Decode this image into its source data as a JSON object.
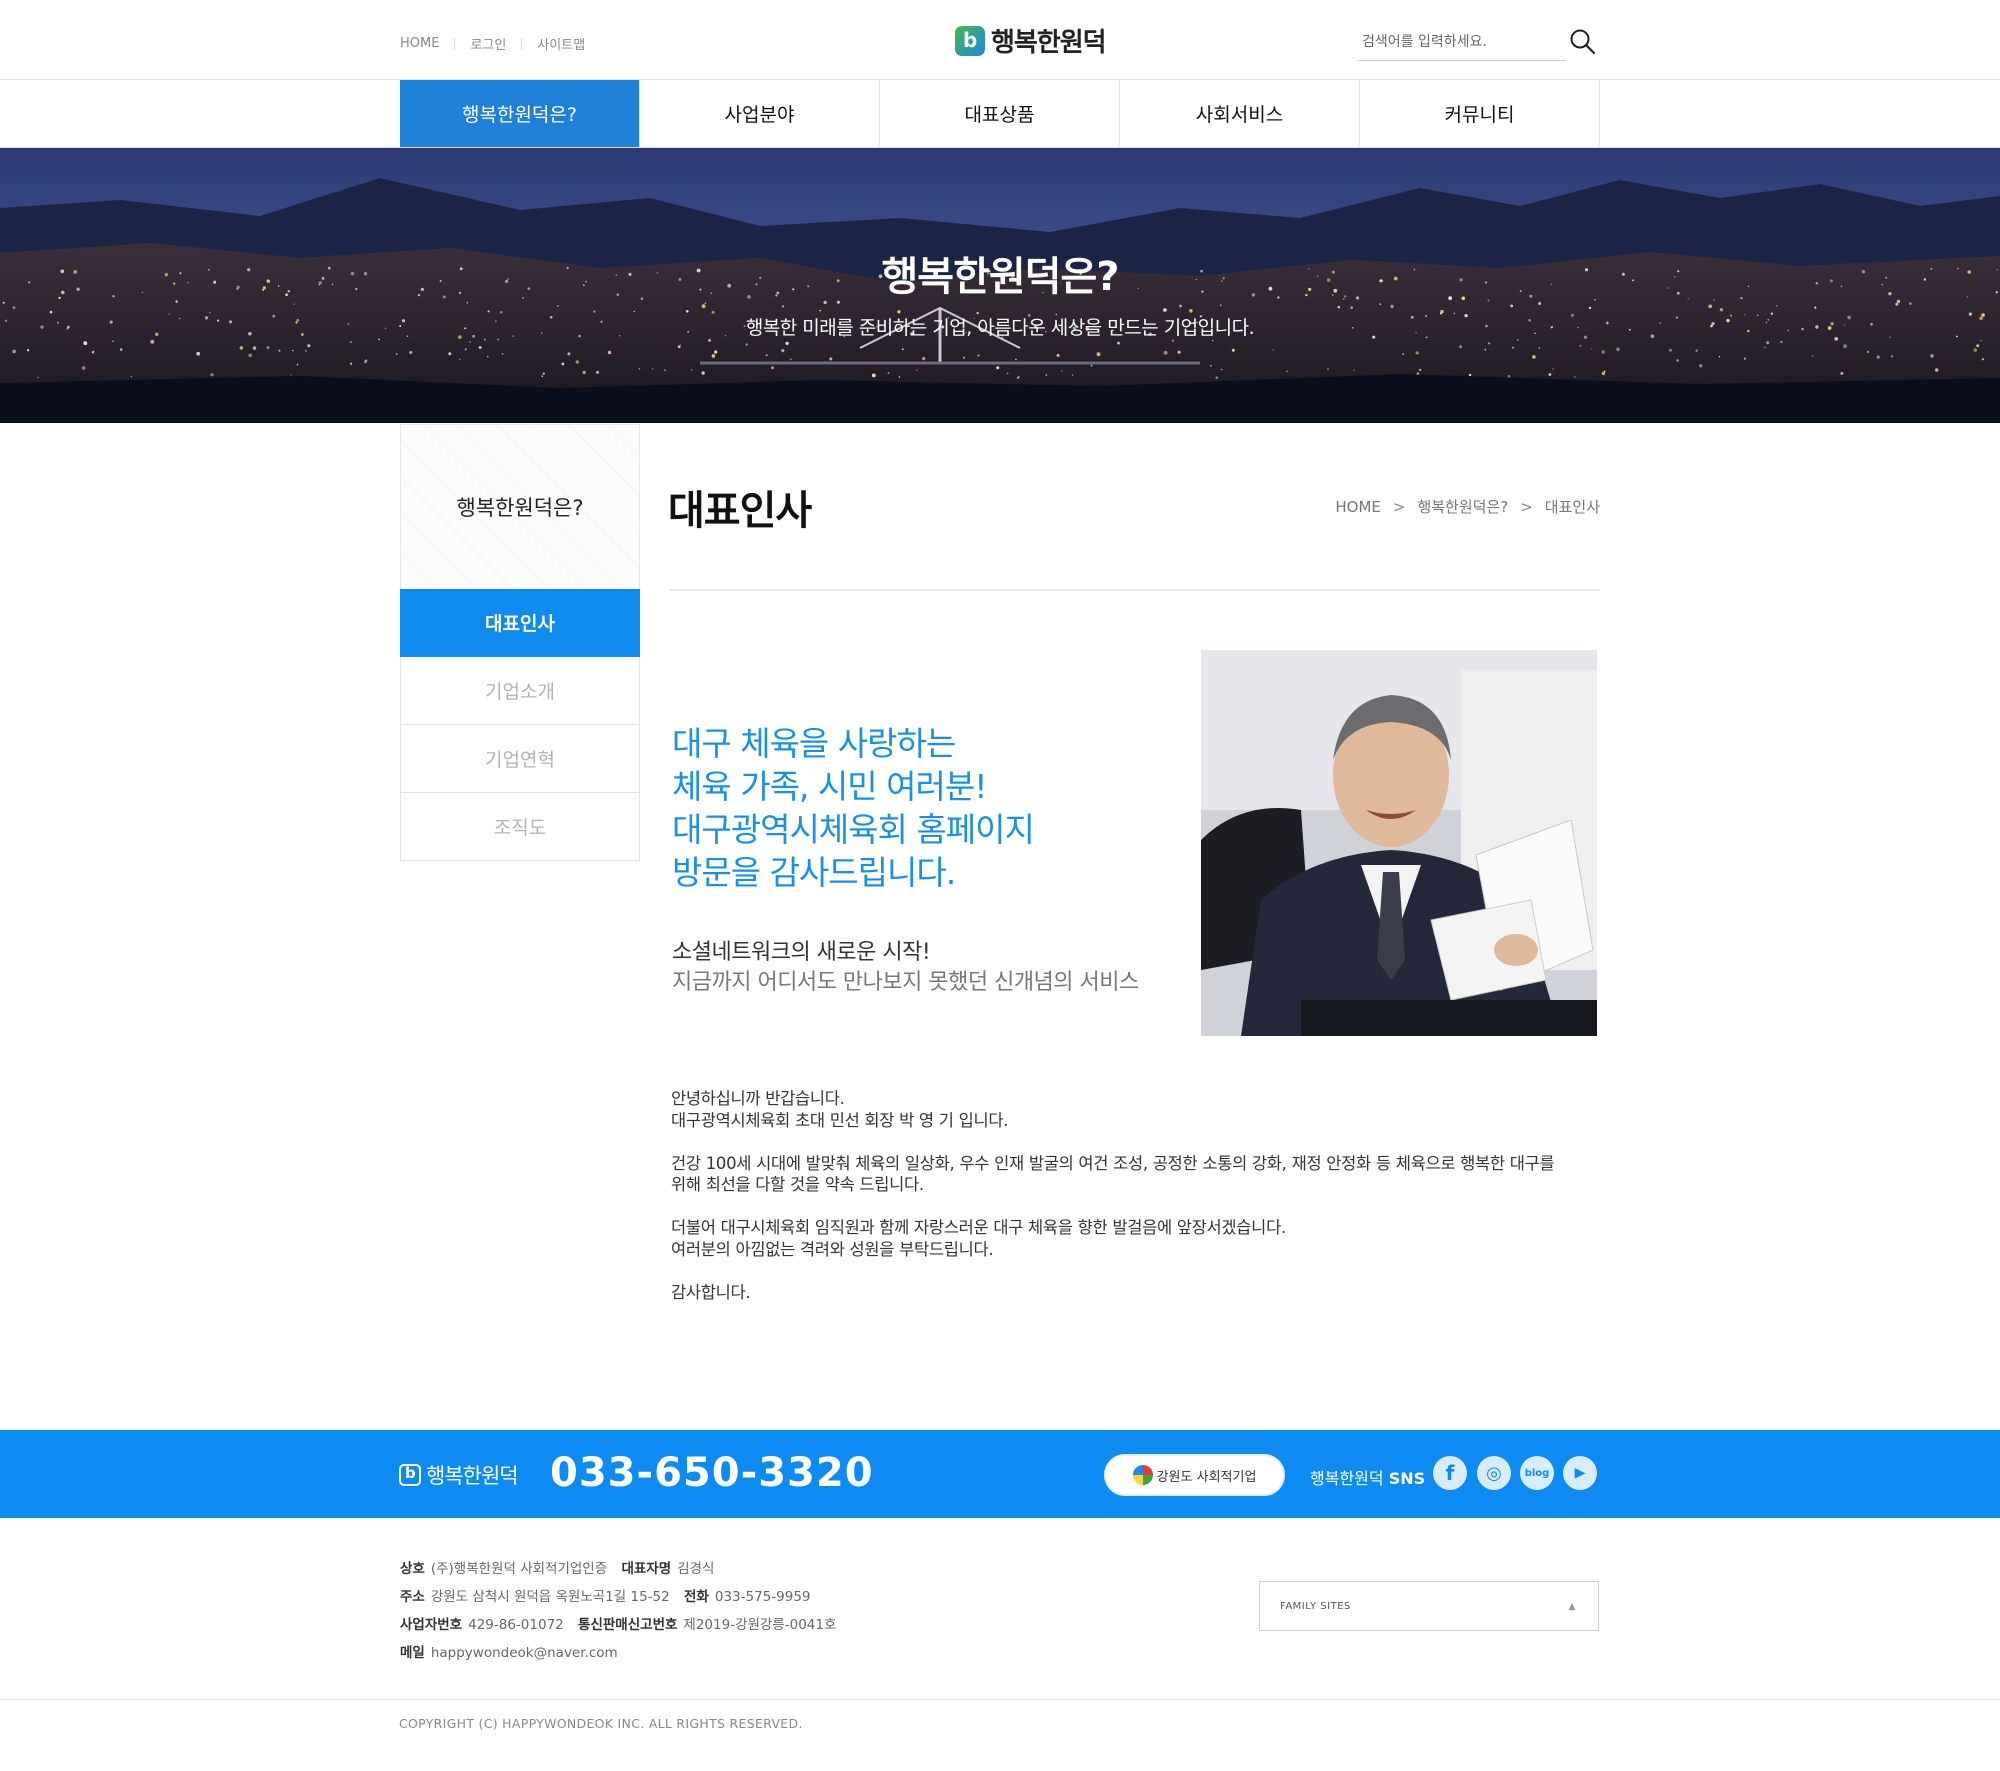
{
  "util_links": [
    "HOME",
    "로그인",
    "사이트맵"
  ],
  "brand": {
    "name": "행복한원덕",
    "mark_color": "#1e88e5",
    "mark_color_2": "#45b849"
  },
  "search": {
    "placeholder": "검색어를 입력하세요.",
    "icon": "search-icon"
  },
  "gnb": [
    {
      "label": "행복한원덕은?",
      "active": true
    },
    {
      "label": "사업분야",
      "active": false
    },
    {
      "label": "대표상품",
      "active": false
    },
    {
      "label": "사회서비스",
      "active": false
    },
    {
      "label": "커뮤니티",
      "active": false
    }
  ],
  "hero": {
    "title": "행복한원덕은?",
    "subtitle": "행복한 미래를 준비하는 기업, 아름다운 세상을 만드는 기업입니다."
  },
  "sidebar": {
    "title": "행복한원덕은?",
    "items": [
      {
        "label": "대표인사",
        "active": true
      },
      {
        "label": "기업소개",
        "active": false
      },
      {
        "label": "기업연혁",
        "active": false
      },
      {
        "label": "조직도",
        "active": false
      }
    ]
  },
  "content": {
    "title": "대표인사",
    "breadcrumb": [
      "HOME",
      "행복한원덕은?",
      "대표인사"
    ],
    "headline": [
      "대구 체육을 사랑하는",
      "체육 가족, 시민 여러분!",
      "대구광역시체육회 홈페이지",
      "방문을 감사드립니다."
    ],
    "subline1": "소셜네트워크의 새로운 시작!",
    "subline2": "지금까지 어디서도 만나보지 못했던 신개념의 서비스",
    "body": [
      [
        "안녕하십니까 반갑습니다.",
        "대구광역시체육회 초대 민선 회장 박 영 기 입니다."
      ],
      [
        "건강 100세 시대에 발맞춰 체육의 일상화, 우수 인재 발굴의 여건 조성, 공정한 소통의 강화, 재정 안정화 등 체육으로 행복한 대구를",
        "위해 최선을 다할 것을 약속 드립니다."
      ],
      [
        "더불어 대구시체육회 임직원과 함께 자랑스러운 대구 체육을 향한 발걸음에 앞장서겠습니다.",
        "여러분의 아낌없는 격려와 성원을 부탁드립니다."
      ],
      [
        "감사합니다."
      ]
    ]
  },
  "footer": {
    "brand": "행복한원덕",
    "phone": "033-650-3320",
    "badge": "강원도 사회적기업",
    "sns_label_prefix": "행복한원덕",
    "sns_label_suffix": "SNS",
    "sns": [
      {
        "name": "facebook-icon",
        "glyph": "f"
      },
      {
        "name": "instagram-icon",
        "glyph": "◎"
      },
      {
        "name": "blog-icon",
        "glyph": "blog"
      },
      {
        "name": "youtube-icon",
        "glyph": "▶"
      }
    ],
    "info": {
      "company_label": "상호",
      "company": "(주)행복한원덕 사회적기업인증",
      "ceo_label": "대표자명",
      "ceo": "김경식",
      "address_label": "주소",
      "address": "강원도 삼척시 원덕읍 옥원노곡1길 15-52",
      "tel_label": "전화",
      "tel": "033-575-9959",
      "bizno_label": "사업자번호",
      "bizno": "429-86-01072",
      "mailorder_label": "통신판매신고번호",
      "mailorder": "제2019-강원강릉-0041호",
      "mail_label": "메일",
      "mail": "happywondeok@naver.com"
    },
    "family_sites": "FAMILY SITES",
    "copyright": "COPYRIGHT (C) HAPPYWONDEOK INC. ALL RIGHTS RESERVED."
  },
  "colors": {
    "primary": "#0f8bf0",
    "gnb_active": "#1e80d6",
    "headline": "#1a8fe8",
    "footer_bar": "#0d8bf2"
  }
}
